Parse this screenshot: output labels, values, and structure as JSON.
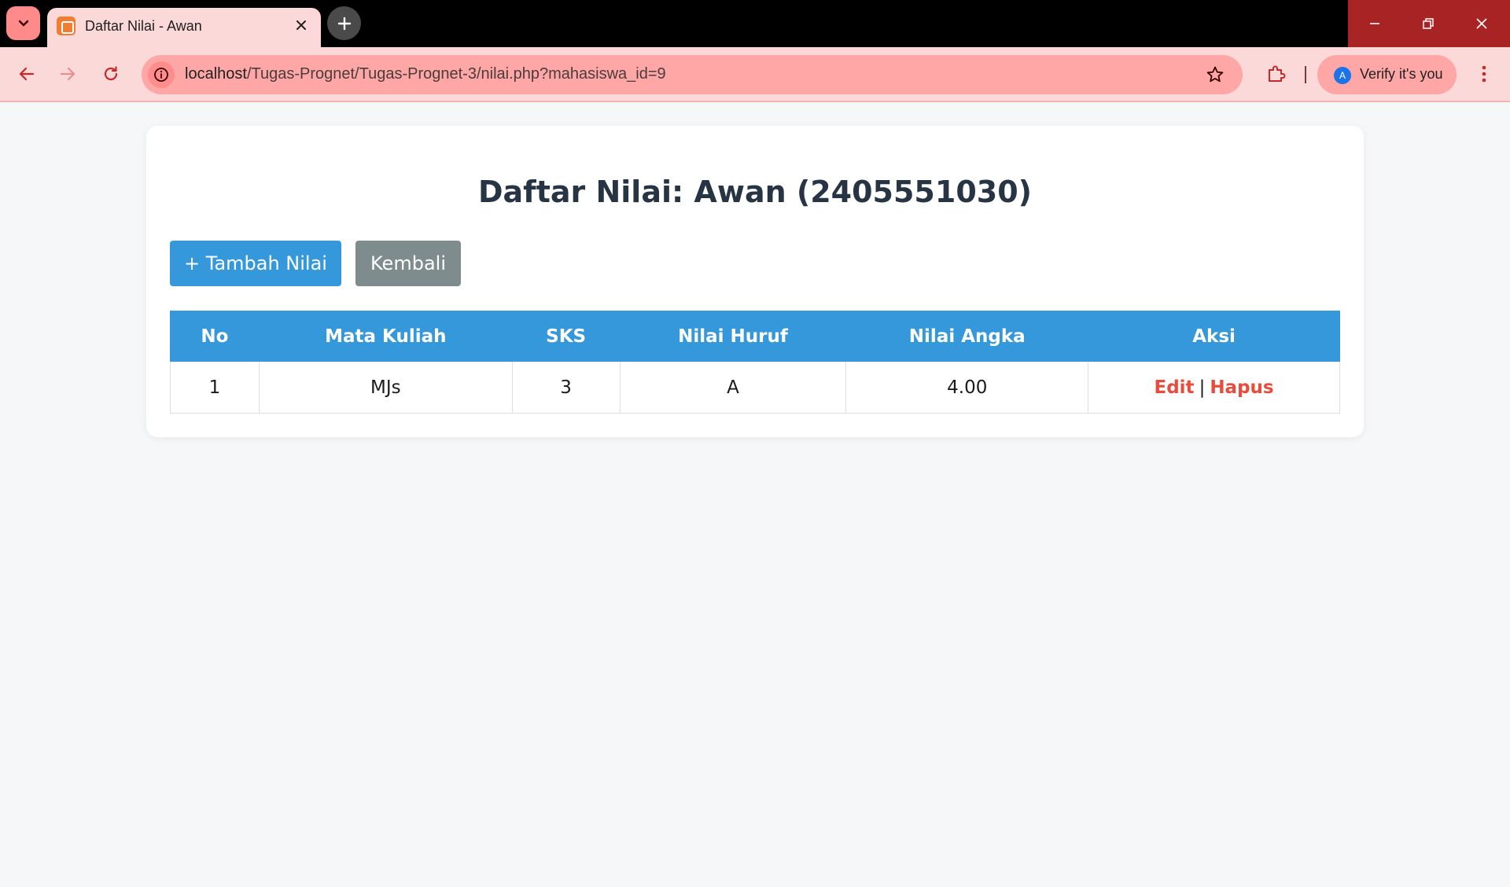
{
  "browser": {
    "tab_title": "Daftar Nilai - Awan",
    "url_host": "localhost",
    "url_path": "/Tugas-Prognet/Tugas-Prognet-3/nilai.php?mahasiswa_id=9",
    "profile_initial": "A",
    "profile_label": "Verify it's you",
    "colors": {
      "titlebar": "#000000",
      "toolbar": "#fbd9d9",
      "omnibox": "#ffa7a7",
      "accent_icon": "#d32f2f"
    }
  },
  "page": {
    "title": "Daftar Nilai: Awan (2405551030)",
    "add_button_label": "+ Tambah Nilai",
    "back_button_label": "Kembali",
    "colors": {
      "primary": "#3498db",
      "secondary": "#7f8c8d",
      "danger": "#e74c3c",
      "heading": "#263444"
    }
  },
  "table": {
    "headers": [
      "No",
      "Mata Kuliah",
      "SKS",
      "Nilai Huruf",
      "Nilai Angka",
      "Aksi"
    ],
    "rows": [
      {
        "no": "1",
        "mata_kuliah": "MJs",
        "sks": "3",
        "nilai_huruf": "A",
        "nilai_angka": "4.00",
        "edit_label": "Edit",
        "separator": "|",
        "delete_label": "Hapus"
      }
    ]
  }
}
